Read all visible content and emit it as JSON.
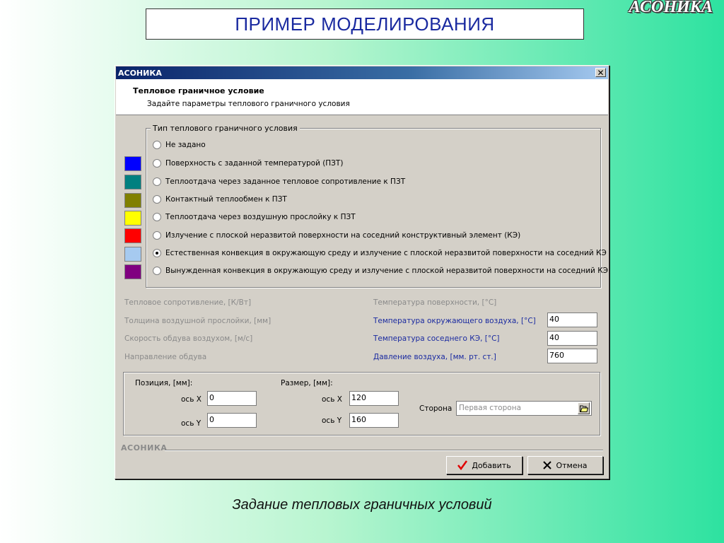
{
  "slide": {
    "title": "ПРИМЕР МОДЕЛИРОВАНИЯ",
    "brand_logo": "АСОНИКА",
    "caption": "Задание тепловых граничных условий"
  },
  "dialog": {
    "window_title": "АСОНИКА",
    "header_title": "Тепловое граничное условие",
    "header_subtitle": "Задайте параметры теплового граничного условия",
    "group_label": "Тип теплового граничного условия",
    "options": [
      {
        "label": "Не задано",
        "swatch": null,
        "checked": false
      },
      {
        "label": "Поверхность с заданной температурой (ПЗТ)",
        "swatch": "#0000ff",
        "checked": false
      },
      {
        "label": "Теплоотдача через заданное тепловое сопротивление к ПЗТ",
        "swatch": "#008080",
        "checked": false
      },
      {
        "label": "Контактный теплообмен к ПЗТ",
        "swatch": "#808000",
        "checked": false
      },
      {
        "label": "Теплоотдача через воздушную прослойку к ПЗТ",
        "swatch": "#ffff00",
        "checked": false
      },
      {
        "label": "Излучение с плоской неразвитой поверхности на соседний конструктивный элемент (КЭ)",
        "swatch": "#ff0000",
        "checked": false
      },
      {
        "label": "Естественная конвекция в окружающую среду и излучение с плоской неразвитой поверхности на соседний КЭ",
        "swatch": "#a6caf0",
        "checked": true
      },
      {
        "label": "Вынужденная конвекция в окружающую среду и излучение с плоской неразвитой поверхности на соседний КЭ",
        "swatch": "#800080",
        "checked": false
      }
    ],
    "params_left": [
      "Тепловое сопротивление, [К/Вт]",
      "Толщина воздушной прослойки, [мм]",
      "Скорость обдува воздухом, [м/с]",
      "Направление обдува"
    ],
    "params_right": [
      {
        "label": "Температура поверхности, [°С]",
        "value": null,
        "enabled": false
      },
      {
        "label": "Температура окружающего воздуха, [°С]",
        "value": "40",
        "enabled": true
      },
      {
        "label": "Температура соседнего КЭ, [°С]",
        "value": "40",
        "enabled": true
      },
      {
        "label": "Давление воздуха, [мм. рт. ст.]",
        "value": "760",
        "enabled": true
      }
    ],
    "position": {
      "label": "Позиция, [мм]:",
      "x_label": "ось X",
      "x": "0",
      "y_label": "ось Y",
      "y": "0"
    },
    "size": {
      "label": "Размер, [мм]:",
      "x_label": "ось X",
      "x": "120",
      "y_label": "ось Y",
      "y": "160"
    },
    "side": {
      "label": "Сторона",
      "value": "Первая сторона"
    },
    "footer_brand": "АСОНИКА",
    "add_button": "Добавить",
    "cancel_button": "Отмена",
    "colors": {
      "accent_text": "#1a2aa0",
      "titlebar_start": "#0a246a",
      "titlebar_end": "#a6caf0",
      "add_icon": "#e00000"
    }
  }
}
